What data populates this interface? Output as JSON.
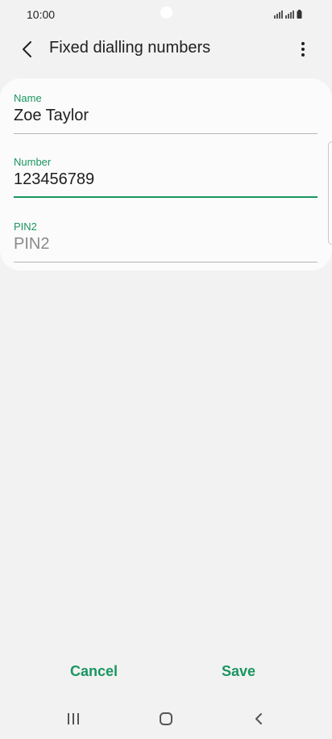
{
  "status_bar": {
    "time": "10:00"
  },
  "app_bar": {
    "title": "Fixed dialling numbers",
    "back_icon": "chevron-left-icon",
    "more_icon": "more-vertical-icon"
  },
  "form": {
    "fields": [
      {
        "label": "Name",
        "value": "Zoe Taylor",
        "placeholder": ""
      },
      {
        "label": "Number",
        "value": "123456789",
        "placeholder": ""
      },
      {
        "label": "PIN2",
        "value": "",
        "placeholder": "PIN2"
      }
    ]
  },
  "actions": {
    "cancel_label": "Cancel",
    "save_label": "Save"
  },
  "nav": {
    "recents_icon": "recents-icon",
    "home_icon": "home-icon",
    "back_icon": "back-icon"
  },
  "colors": {
    "accent": "#1a9660",
    "background": "#f2f2f2",
    "card": "#fbfbfb"
  }
}
